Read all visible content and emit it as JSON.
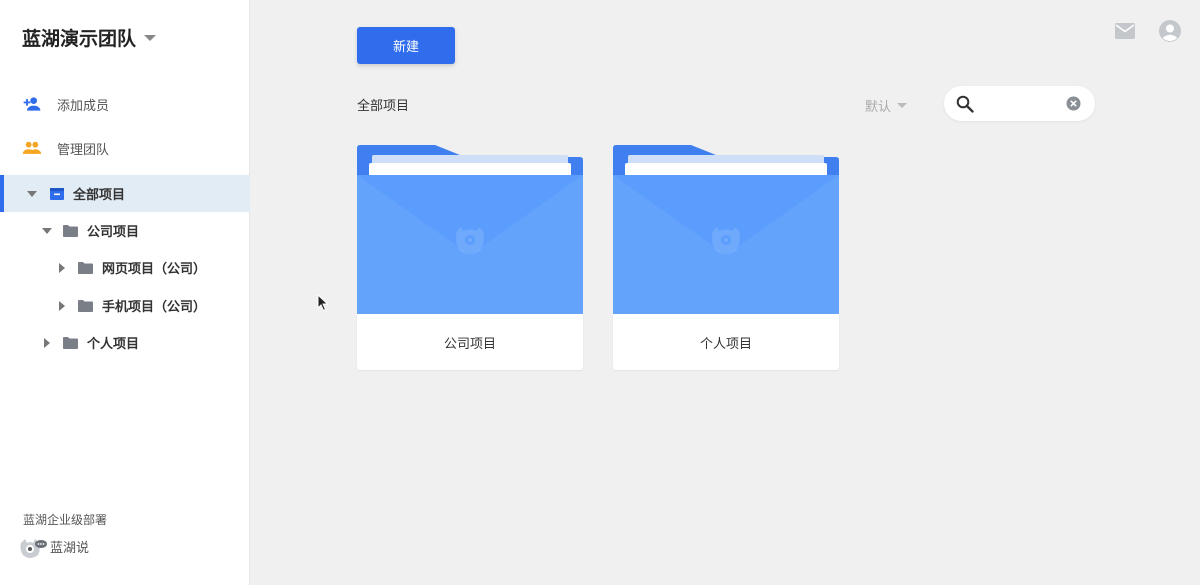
{
  "team": {
    "name": "蓝湖演示团队"
  },
  "menu": {
    "add_member": "添加成员",
    "manage_team": "管理团队"
  },
  "tree": {
    "all_projects": "全部项目",
    "company_projects": "公司项目",
    "web_projects": "网页项目（公司）",
    "mobile_projects": "手机项目（公司）",
    "personal_projects": "个人项目"
  },
  "footer": {
    "enterprise": "蓝湖企业级部署",
    "lanhu_says": "蓝湖说"
  },
  "toolbar": {
    "new_label": "新建"
  },
  "main": {
    "section_title": "全部项目",
    "sort_label": "默认",
    "search_placeholder": ""
  },
  "cards": [
    {
      "title": "公司项目"
    },
    {
      "title": "个人项目"
    }
  ],
  "icons": {
    "add_member": "add-person-icon",
    "manage_team": "people-icon",
    "all_projects": "archive-box-icon",
    "folder": "folder-icon",
    "search": "search-icon",
    "clear": "clear-icon",
    "mail": "mail-icon",
    "account": "account-icon",
    "logo": "lanhu-logo-icon"
  },
  "colors": {
    "accent": "#2f6ded",
    "folder_blue": "#5b9dfc",
    "folder_tab": "#3f7ff0",
    "menu_icon_blue": "#2f6ded",
    "menu_icon_orange": "#f5a623",
    "active_row": "#e1ecf4"
  }
}
